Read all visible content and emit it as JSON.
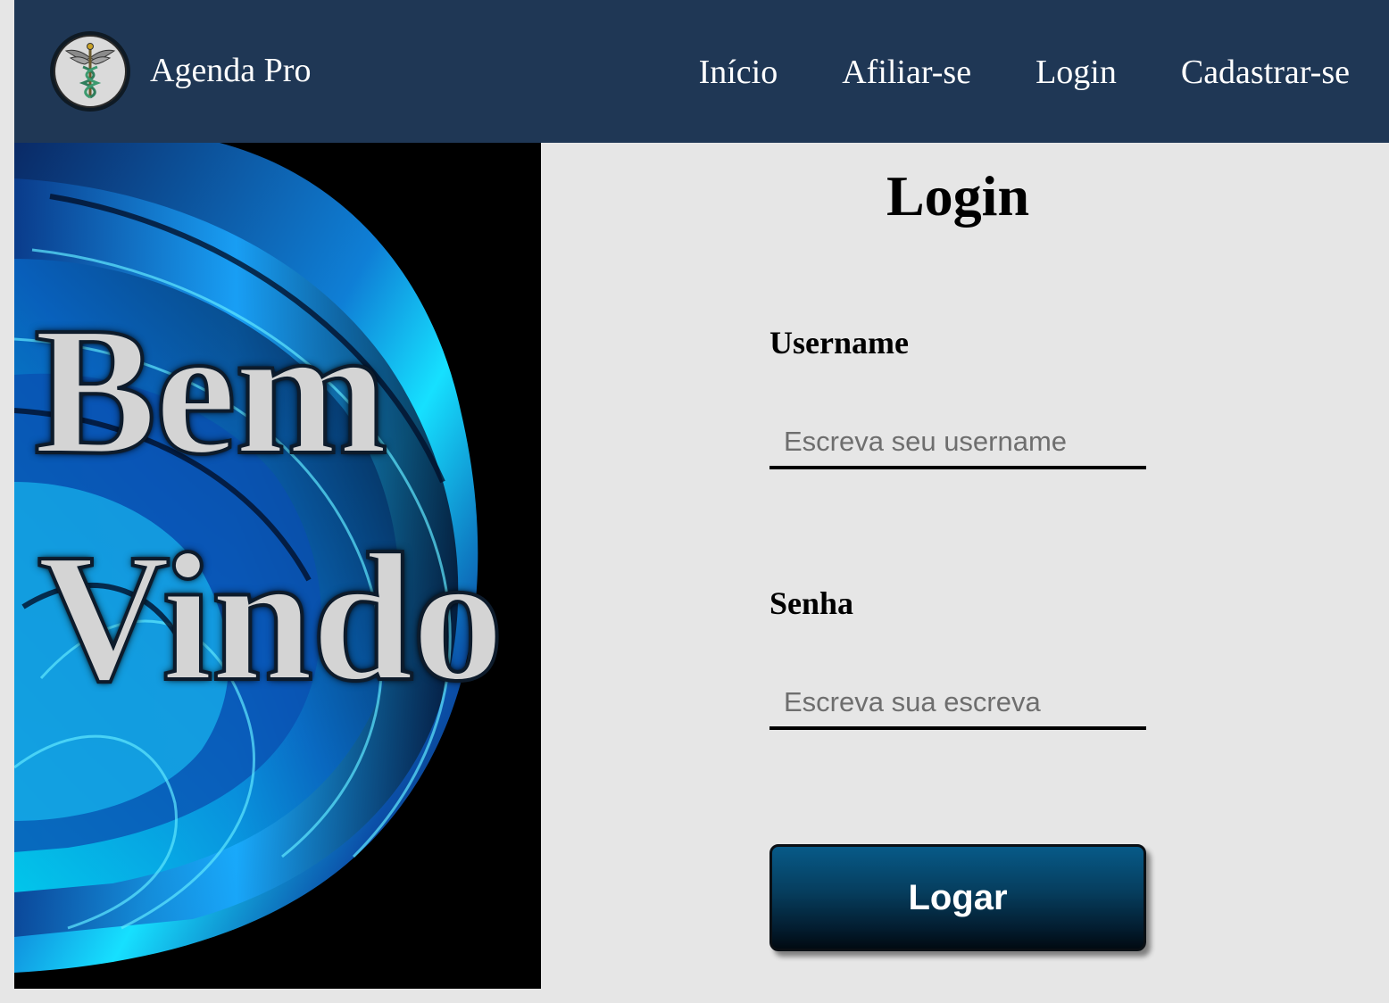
{
  "header": {
    "brand": "Agenda Pro",
    "logo_icon": "caduceus-icon",
    "background": "#1f3755",
    "nav": [
      {
        "label": "Início"
      },
      {
        "label": "Afiliar-se"
      },
      {
        "label": "Login"
      },
      {
        "label": "Cadastrar-se"
      }
    ]
  },
  "hero": {
    "line1": "Bem",
    "line2": "Vindo",
    "background_art": "blue-abstract-waves"
  },
  "form": {
    "title": "Login",
    "username_label": "Username",
    "username_placeholder": "Escreva seu username",
    "password_label": "Senha",
    "password_placeholder": "Escreva sua escreva",
    "submit_label": "Logar"
  }
}
